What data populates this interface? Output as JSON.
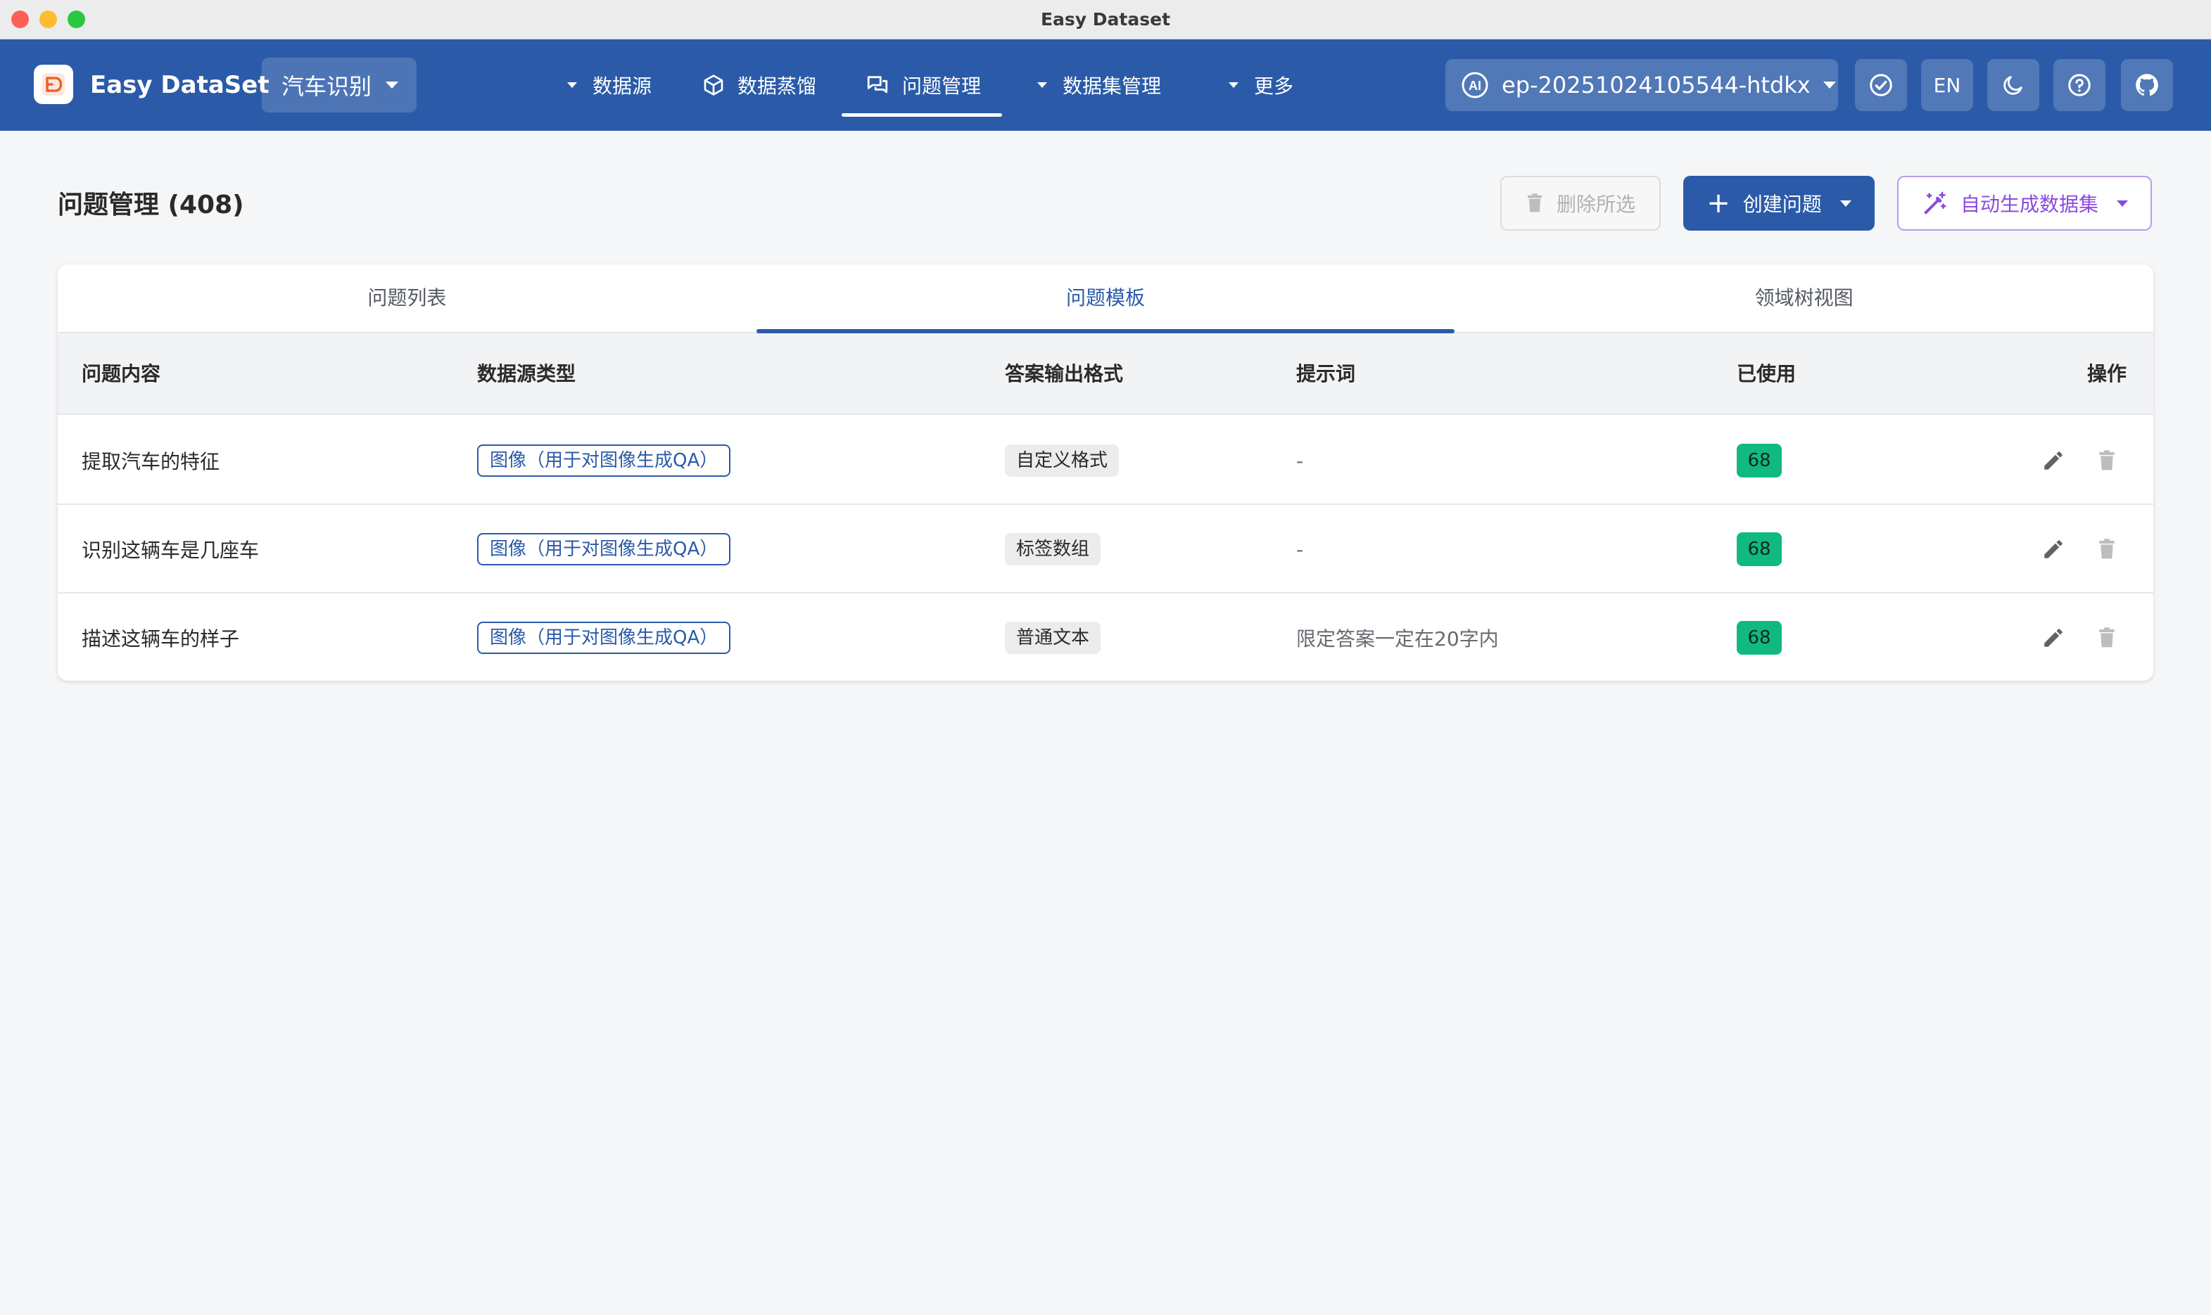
{
  "window": {
    "title": "Easy Dataset"
  },
  "header": {
    "brand": "Easy DataSet",
    "project": "汽车识别",
    "nav": {
      "datasource": "数据源",
      "distill": "数据蒸馏",
      "questions": "问题管理",
      "datasets": "数据集管理",
      "more": "更多"
    },
    "model": "ep-20251024105544-htdkx",
    "lang": "EN"
  },
  "page": {
    "title": "问题管理 (408)",
    "delete_selected": "删除所选",
    "create_question": "创建问题",
    "auto_generate": "自动生成数据集"
  },
  "tabs": [
    "问题列表",
    "问题模板",
    "领域树视图"
  ],
  "table": {
    "columns": [
      "问题内容",
      "数据源类型",
      "答案输出格式",
      "提示词",
      "已使用",
      "操作"
    ],
    "rows": [
      {
        "question": "提取汽车的特征",
        "source": "图像（用于对图像生成QA）",
        "format": "自定义格式",
        "prompt": "-",
        "used": "68"
      },
      {
        "question": "识别这辆车是几座车",
        "source": "图像（用于对图像生成QA）",
        "format": "标签数组",
        "prompt": "-",
        "used": "68"
      },
      {
        "question": "描述这辆车的样子",
        "source": "图像（用于对图像生成QA）",
        "format": "普通文本",
        "prompt": "限定答案一定在20字内",
        "used": "68"
      }
    ]
  },
  "colors": {
    "primary": "#2b5ba8",
    "success": "#10b981",
    "accent": "#8a4be0"
  }
}
